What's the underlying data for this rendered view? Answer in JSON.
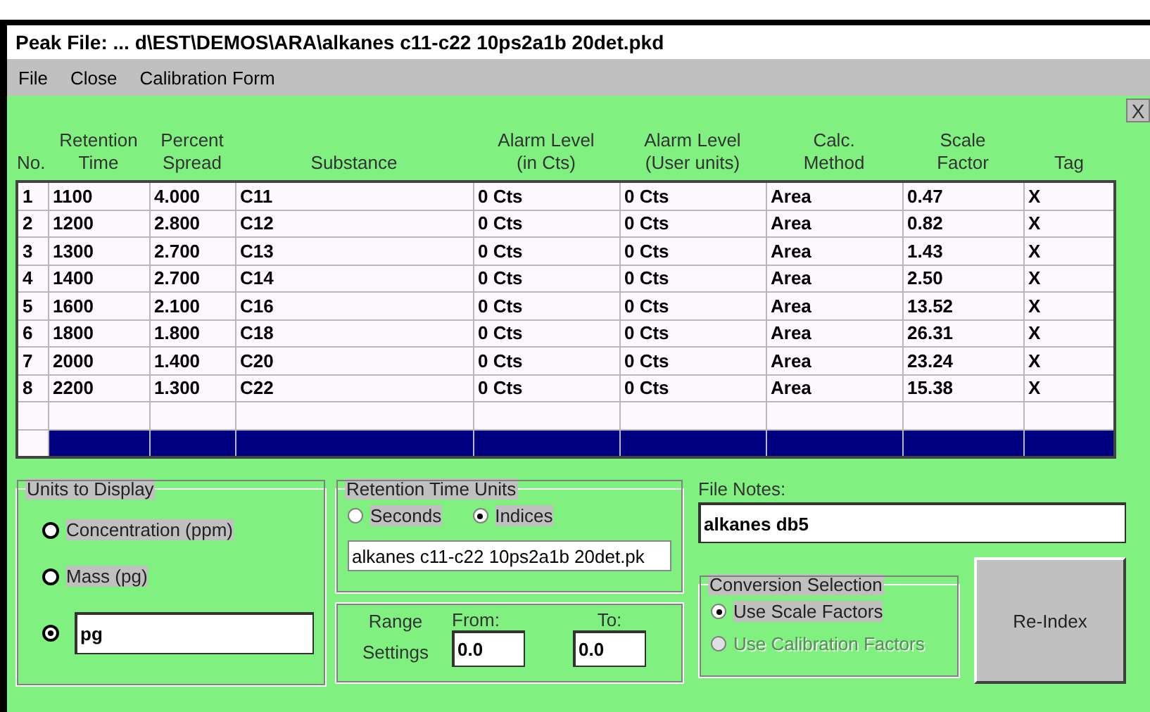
{
  "window": {
    "title": "Peak File:  ... d\\EST\\DEMOS\\ARA\\alkanes c11-c22 10ps2a1b 20det.pkd"
  },
  "menu": [
    {
      "label": "File"
    },
    {
      "label": "Close"
    },
    {
      "label": "Calibration Form"
    }
  ],
  "close_button": {
    "label": "X"
  },
  "table": {
    "columns": [
      "No.",
      "Retention Time",
      "Percent Spread",
      "Substance",
      "Alarm Level (in Cts)",
      "Alarm Level (User units)",
      "Calc. Method",
      "Scale Factor",
      "Tag"
    ],
    "rows": [
      {
        "cells": [
          "1",
          "1100",
          "4.000",
          "C11",
          "0 Cts",
          "0 Cts",
          "Area",
          "0.47",
          "X"
        ],
        "selected": false
      },
      {
        "cells": [
          "2",
          "1200",
          "2.800",
          "C12",
          "0 Cts",
          "0 Cts",
          "Area",
          "0.82",
          "X"
        ],
        "selected": false
      },
      {
        "cells": [
          "3",
          "1300",
          "2.700",
          "C13",
          "0 Cts",
          "0 Cts",
          "Area",
          "1.43",
          "X"
        ],
        "selected": false
      },
      {
        "cells": [
          "4",
          "1400",
          "2.700",
          "C14",
          "0 Cts",
          "0 Cts",
          "Area",
          "2.50",
          "X"
        ],
        "selected": false
      },
      {
        "cells": [
          "5",
          "1600",
          "2.100",
          "C16",
          "0 Cts",
          "0 Cts",
          "Area",
          "13.52",
          "X"
        ],
        "selected": false
      },
      {
        "cells": [
          "6",
          "1800",
          "1.800",
          "C18",
          "0 Cts",
          "0 Cts",
          "Area",
          "26.31",
          "X"
        ],
        "selected": false
      },
      {
        "cells": [
          "7",
          "2000",
          "1.400",
          "C20",
          "0 Cts",
          "0 Cts",
          "Area",
          "23.24",
          "X"
        ],
        "selected": false
      },
      {
        "cells": [
          "8",
          "2200",
          "1.300",
          "C22",
          "0 Cts",
          "0 Cts",
          "Area",
          "15.38",
          "X"
        ],
        "selected": false
      },
      {
        "cells": [],
        "selected": false
      },
      {
        "cells": [],
        "selected": true
      }
    ]
  },
  "units_to_display": {
    "title": "Units to Display",
    "options": [
      {
        "kind": "label",
        "label": "Concentration (ppm)",
        "selected": false
      },
      {
        "kind": "label",
        "label": "Mass (pg)",
        "selected": false
      },
      {
        "kind": "input",
        "value": "pg",
        "selected": true
      }
    ]
  },
  "retention_time_units": {
    "title": "Retention Time Units",
    "options": [
      {
        "label": "Seconds",
        "selected": false
      },
      {
        "label": "Indices",
        "selected": true
      }
    ],
    "file_field": "alkanes c11-c22 10ps2a1b 20det.pk"
  },
  "range_settings": {
    "label": "Range Settings",
    "from_label": "From:",
    "from": "0.0",
    "to_label": "To:",
    "to": "0.0"
  },
  "file_notes": {
    "label": "File Notes:",
    "value": "alkanes db5"
  },
  "conversion_selection": {
    "title": "Conversion Selection",
    "options": [
      {
        "label": "Use Scale Factors",
        "selected": true,
        "disabled": false
      },
      {
        "label": "Use Calibration Factors",
        "selected": false,
        "disabled": true
      }
    ]
  },
  "reindex_button": {
    "label": "Re-Index"
  }
}
